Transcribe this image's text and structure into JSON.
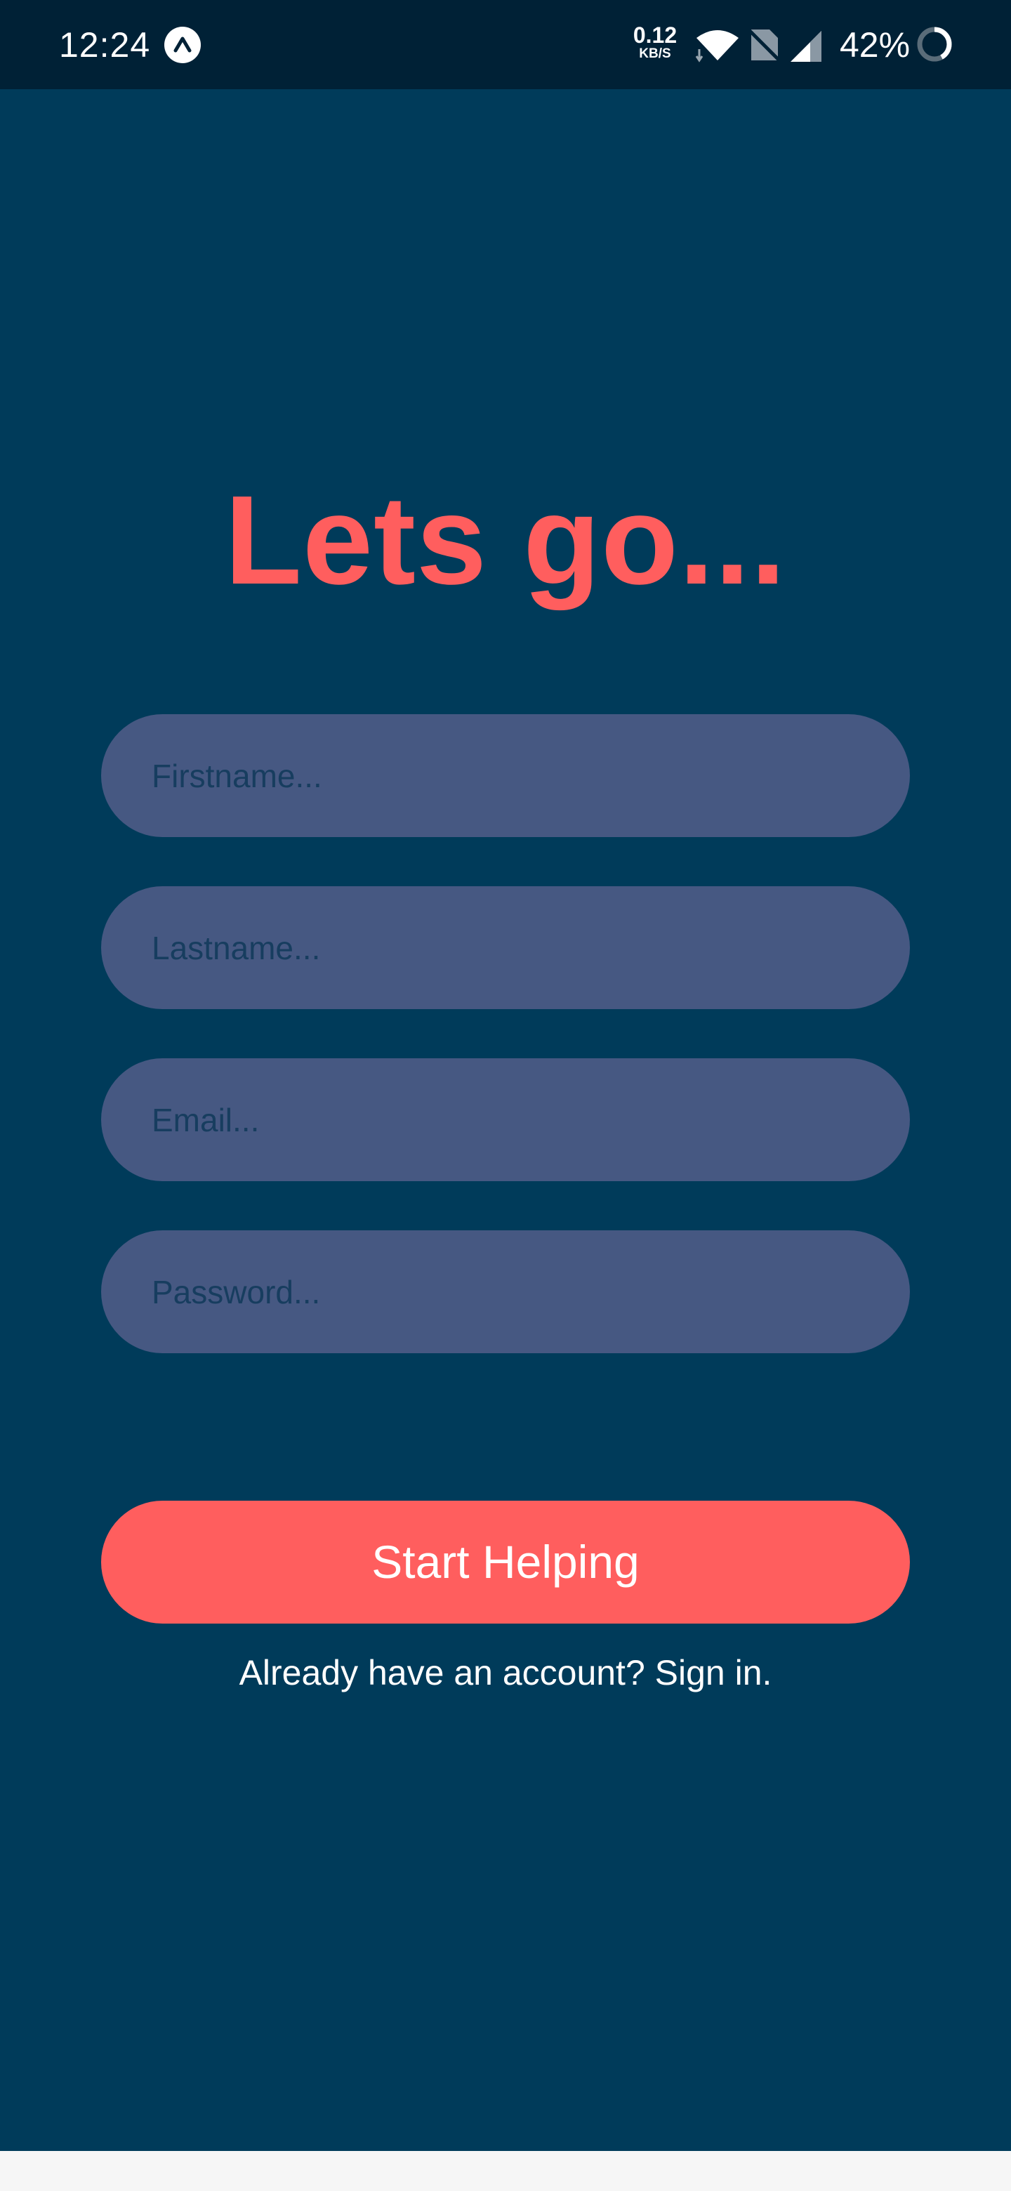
{
  "status_bar": {
    "time": "12:24",
    "net_speed_value": "0.12",
    "net_speed_unit": "KB/S",
    "battery_percent": "42%",
    "background": "#002136"
  },
  "screen": {
    "background": "#003b5a",
    "title": "Lets go...",
    "accent_color": "#ff5e5e",
    "field_color": "#465882"
  },
  "form": {
    "firstname_placeholder": "Firstname...",
    "lastname_placeholder": "Lastname...",
    "email_placeholder": "Email...",
    "password_placeholder": "Password..."
  },
  "actions": {
    "start_label": "Start Helping",
    "signin_text": "Already have an account? Sign in."
  }
}
